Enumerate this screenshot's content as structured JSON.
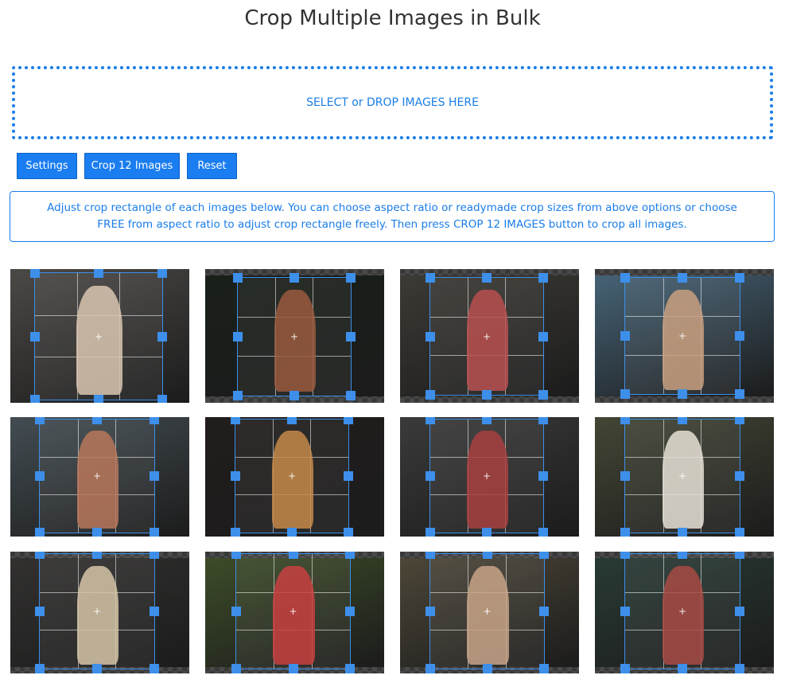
{
  "page": {
    "title": "Crop Multiple Images in Bulk"
  },
  "dropzone": {
    "label": "SELECT or DROP IMAGES HERE"
  },
  "toolbar": {
    "settings_label": "Settings",
    "crop_label": "Crop 12 Images",
    "reset_label": "Reset"
  },
  "info": {
    "text": "Adjust crop rectangle of each images below. You can choose aspect ratio or readymade crop sizes from above options or choose FREE from aspect ratio to adjust crop rectangle freely. Then press CROP 12 IMAGES button to crop all images."
  },
  "colors": {
    "accent": "#1a7de8",
    "handle": "#3d8fea"
  },
  "images": [
    {
      "name": "woman-on-stairs",
      "bg": "#8a8580",
      "fig": "#d9c7b0"
    },
    {
      "name": "redhead-in-forest",
      "bg": "#2f3b30",
      "fig": "#9a5a3e"
    },
    {
      "name": "two-kids-on-bridge",
      "bg": "#6e6a60",
      "fig": "#b85050"
    },
    {
      "name": "woman-jumping-beach",
      "bg": "#7fb3d6",
      "fig": "#c9a080"
    },
    {
      "name": "bob-haircut-portrait",
      "bg": "#7a8c96",
      "fig": "#b8775a"
    },
    {
      "name": "curly-redhead-portrait",
      "bg": "#3d3633",
      "fig": "#c58a4a"
    },
    {
      "name": "girl-with-skates",
      "bg": "#6c6a6a",
      "fig": "#a84040"
    },
    {
      "name": "woman-with-white-tiger",
      "bg": "#7a8060",
      "fig": "#e8e2d6"
    },
    {
      "name": "woman-with-scarf",
      "bg": "#5c5a58",
      "fig": "#d6c4a8"
    },
    {
      "name": "kids-with-camera",
      "bg": "#6f8a4a",
      "fig": "#c84040"
    },
    {
      "name": "woman-in-field",
      "bg": "#8c8066",
      "fig": "#c8a488"
    },
    {
      "name": "woman-in-water-hat",
      "bg": "#4a6a60",
      "fig": "#a84a44"
    }
  ]
}
